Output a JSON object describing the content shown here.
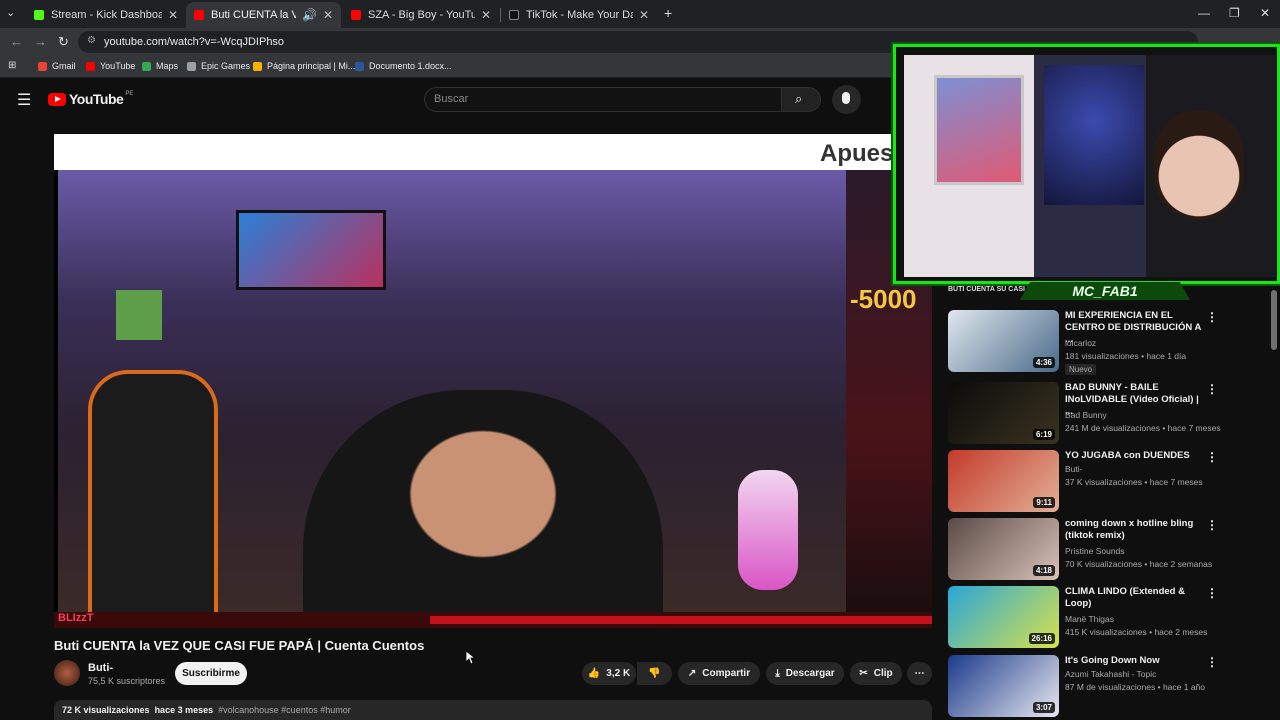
{
  "browser": {
    "tabs": [
      {
        "title": "Stream - Kick Dashboard",
        "favicon_color": "#53fc18"
      },
      {
        "title": "Buti CUENTA la VEZ QUE CA",
        "favicon_color": "#ff0000"
      },
      {
        "title": "SZA - Big Boy - YouTube",
        "favicon_color": "#ff0000"
      },
      {
        "title": "TikTok - Make Your Day",
        "favicon_color": "#111111"
      }
    ],
    "new_tab": "+",
    "url": "youtube.com/watch?v=-WcqJDIPhso",
    "bookmarks": [
      {
        "label": "Gmail",
        "color": "#ea4335"
      },
      {
        "label": "YouTube",
        "color": "#ff0000"
      },
      {
        "label": "Maps",
        "color": "#34a853"
      },
      {
        "label": "Epic Games",
        "color": "#9aa0a6"
      },
      {
        "label": "Página principal | Mi...",
        "color": "#f4b400"
      },
      {
        "label": "Documento 1.docx...",
        "color": "#2b579a"
      }
    ]
  },
  "youtube": {
    "logo": "YouTube",
    "region": "PE",
    "search_placeholder": "Buscar"
  },
  "video": {
    "overlay_top": "Apues",
    "overlay_number": "-5000",
    "overlay_tag": "BLIzzT",
    "title": "Buti CUENTA la VEZ QUE CASI FUE PAPÁ | Cuenta Cuentos",
    "channel": "Buti-",
    "subscribers": "75,5 K suscriptores",
    "subscribe_label": "Suscribirme",
    "likes": "3,2 K",
    "share_label": "Compartir",
    "download_label": "Descargar",
    "clip_label": "Clip",
    "views": "72 K visualizaciones",
    "age": "hace 3 meses",
    "tags": "#volcanohouse #cuentos #humor"
  },
  "webcam": {
    "name": "MC_FAB1",
    "peek_text": "BUTI CUENTA SU CASI PRIMER HIJ"
  },
  "recommendations": [
    {
      "title": "MI EXPERIENCIA EN EL CENTRO DE DISTRIBUCIÓN A ...",
      "channel": "lolcarloz",
      "meta": "181 visualizaciones • hace 1 día",
      "badge": "Nuevo",
      "duration": "4:36",
      "thumb_a": "#dfe7ee",
      "thumb_b": "#4a6a8a"
    },
    {
      "title": "BAD BUNNY - BAILE INoLVIDABLE (Video Oficial) | ...",
      "channel": "Bad Bunny",
      "meta": "241 M de visualizaciones • hace 7 meses",
      "badge": "",
      "duration": "6:19",
      "thumb_a": "#0b0b0b",
      "thumb_b": "#3a3320"
    },
    {
      "title": "YO JUGABA con DUENDES",
      "channel": "Buti-",
      "meta": "37 K visualizaciones • hace 7 meses",
      "badge": "",
      "duration": "9:11",
      "thumb_a": "#c43a2a",
      "thumb_b": "#e2b096"
    },
    {
      "title": "coming down x hotline bling (tiktok remix)",
      "channel": "Pristine Sounds",
      "meta": "70 K visualizaciones • hace 2 semanas",
      "badge": "",
      "duration": "4:18",
      "thumb_a": "#5a4a46",
      "thumb_b": "#d9c2b8"
    },
    {
      "title": "CLIMA LINDO (Extended & Loop)",
      "channel": "Manë Thigas",
      "meta": "415 K visualizaciones • hace 2 meses",
      "badge": "",
      "duration": "26:16",
      "thumb_a": "#2aa6d8",
      "thumb_b": "#d8e24a"
    },
    {
      "title": "It's Going Down Now",
      "channel": "Azumi Takahashi - Topic",
      "meta": "87 M de visualizaciones • hace 1 año",
      "badge": "",
      "duration": "3:07",
      "thumb_a": "#1a3a8a",
      "thumb_b": "#e8e8f0"
    }
  ]
}
